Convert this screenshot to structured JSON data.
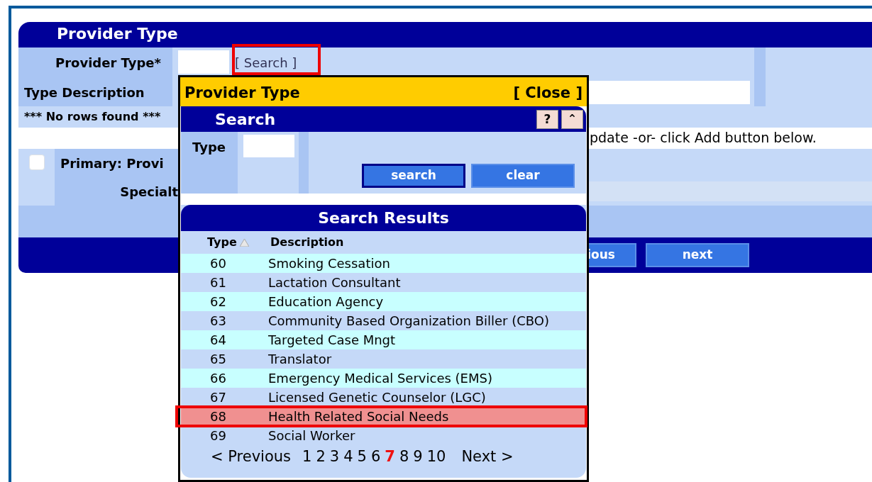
{
  "panel": {
    "title": "Provider Type",
    "provider_type": {
      "label": "Provider Type*",
      "search_link": {
        "label": "[ Search ]",
        "annotated": true
      }
    },
    "type_description": {
      "label": "Type Description"
    },
    "no_rows": "*** No rows found ***",
    "message": "pdate -or- click Add button below.",
    "primary": {
      "label": "Primary: Provi",
      "checked": false
    },
    "specialty": {
      "label": "Specialt"
    },
    "buttons": [
      "ious",
      "next"
    ]
  },
  "popup": {
    "title": "Provider Type",
    "close": "[ Close ]",
    "search": {
      "title": "Search",
      "help": "?",
      "collapse": "⌃",
      "type_label": "Type",
      "buttons": [
        "search",
        "clear"
      ]
    },
    "results": {
      "title": "Search Results",
      "columns": [
        {
          "label": "Type",
          "sorted": true
        },
        {
          "label": "Description",
          "sorted": false
        }
      ],
      "rows": [
        {
          "type": "60",
          "description": "Smoking Cessation",
          "selected": false,
          "annotated": false
        },
        {
          "type": "61",
          "description": "Lactation Consultant",
          "selected": false,
          "annotated": false
        },
        {
          "type": "62",
          "description": "Education Agency",
          "selected": false,
          "annotated": false
        },
        {
          "type": "63",
          "description": "Community Based Organization Biller (CBO)",
          "selected": false,
          "annotated": false
        },
        {
          "type": "64",
          "description": "Targeted Case Mngt",
          "selected": false,
          "annotated": false
        },
        {
          "type": "65",
          "description": "Translator",
          "selected": false,
          "annotated": false
        },
        {
          "type": "66",
          "description": "Emergency Medical Services (EMS)",
          "selected": false,
          "annotated": false
        },
        {
          "type": "67",
          "description": "Licensed Genetic Counselor (LGC)",
          "selected": false,
          "annotated": false
        },
        {
          "type": "68",
          "description": "Health Related Social Needs",
          "selected": true,
          "annotated": true
        },
        {
          "type": "69",
          "description": "Social Worker",
          "selected": false,
          "annotated": false
        }
      ],
      "pager": {
        "previous": "< Previous",
        "next": "Next >",
        "pages": [
          {
            "label": "1",
            "selected": false
          },
          {
            "label": "2",
            "selected": false
          },
          {
            "label": "3",
            "selected": false
          },
          {
            "label": "4",
            "selected": false
          },
          {
            "label": "5",
            "selected": false
          },
          {
            "label": "6",
            "selected": false
          },
          {
            "label": "7",
            "selected": true
          },
          {
            "label": "8",
            "selected": false
          },
          {
            "label": "9",
            "selected": false
          },
          {
            "label": "10",
            "selected": false
          }
        ]
      }
    }
  }
}
